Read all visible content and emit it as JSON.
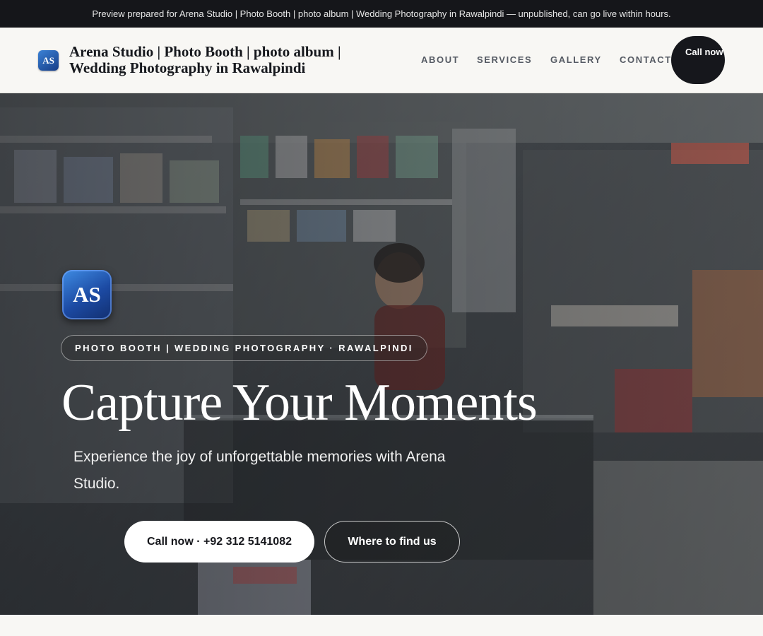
{
  "banner": {
    "text": "Preview prepared for Arena Studio | Photo Booth | photo album | Wedding Photography in Rawalpindi — unpublished, can go live within hours."
  },
  "header": {
    "logo_initials": "AS",
    "title": "Arena Studio | Photo Booth | photo album | Wedding Photography in Rawalpindi",
    "nav": {
      "about": "ABOUT",
      "services": "SERVICES",
      "gallery": "GALLERY",
      "contact": "CONTACT"
    },
    "call_button": "Call now"
  },
  "hero": {
    "logo_initials": "AS",
    "tagline": "PHOTO BOOTH | WEDDING PHOTOGRAPHY · RAWALPINDI",
    "title": "Capture Your Moments",
    "subtitle": "Experience the joy of unforgettable memories with Arena Studio.",
    "primary_button": "Call now · +92 312 5141082",
    "secondary_button": "Where to find us"
  },
  "colors": {
    "dark": "#16171c",
    "page_bg": "#f8f7f4",
    "logo_blue": "#1c4aa3"
  }
}
